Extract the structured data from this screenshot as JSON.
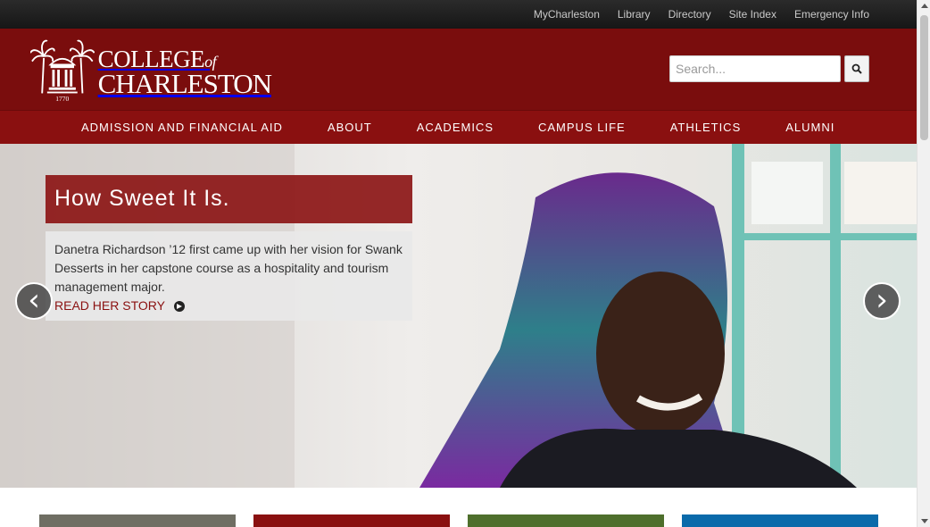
{
  "utility_nav": [
    "MyCharleston",
    "Library",
    "Directory",
    "Site Index",
    "Emergency Info"
  ],
  "logo": {
    "line1": "COLLEGE",
    "of": "of",
    "line2": "CHARLESTON",
    "year": "1770"
  },
  "search": {
    "placeholder": "Search...",
    "icon": "search-icon"
  },
  "main_nav": [
    "ADMISSION AND FINANCIAL AID",
    "ABOUT",
    "ACADEMICS",
    "CAMPUS LIFE",
    "ATHLETICS",
    "ALUMNI"
  ],
  "hero": {
    "title": "How Sweet It Is.",
    "body": "Danetra Richardson ’12 first came up with her vision for Swank Desserts in her capstone course as a hospitality and tourism management major.",
    "link": "READ HER STORY",
    "prev_symbol": "‹",
    "next_symbol": "›"
  },
  "tiles": [
    {
      "color": "#6f6e63"
    },
    {
      "color": "#8a1010"
    },
    {
      "color": "#4e6f2c"
    },
    {
      "color": "#0a6aaa"
    }
  ],
  "colors": {
    "brand": "#7a0d0d",
    "nav": "#8a1010",
    "utility": "#1e1e1e"
  }
}
